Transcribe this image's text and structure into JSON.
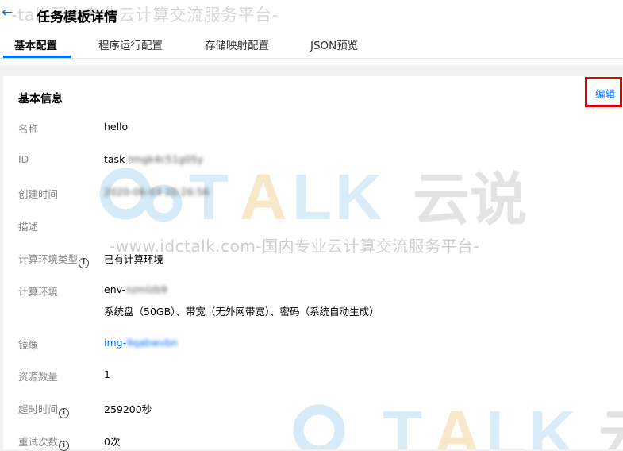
{
  "header": {
    "back_icon": "arrow-left-icon",
    "title": "任务模板详情",
    "watermark": "-talk国内专业云计算交流服务平台-"
  },
  "tabs": [
    {
      "label": "基本配置",
      "active": true
    },
    {
      "label": "程序运行配置",
      "active": false
    },
    {
      "label": "存储映射配置",
      "active": false
    },
    {
      "label": "JSON预览",
      "active": false
    }
  ],
  "section": {
    "title": "基本信息",
    "edit_label": "编辑"
  },
  "fields": {
    "name": {
      "label": "名称",
      "value": "hello"
    },
    "id": {
      "label": "ID",
      "prefix": "task-",
      "masked": "tmgk4c51g05y"
    },
    "created": {
      "label": "创建时间",
      "value": "2020-06-03 20:26:56"
    },
    "description": {
      "label": "描述",
      "value": ""
    },
    "env_type": {
      "label": "计算环境类型",
      "value": "已有计算环境"
    },
    "env": {
      "label": "计算环境",
      "prefix": "env-",
      "masked": "nzmlzb9",
      "detail": "系统盘（50GB）、带宽（无外网带宽）、密码（系统自动生成）"
    },
    "image": {
      "label": "镜像",
      "prefix": "img-",
      "masked": "9qabwvbn"
    },
    "resource_count": {
      "label": "资源数量",
      "value": "1"
    },
    "timeout": {
      "label": "超时时间",
      "value": "259200秒"
    },
    "retry": {
      "label": "重试次数",
      "value": "0次"
    }
  },
  "watermark": {
    "logo_text": "TALK",
    "logo_cn": "云说",
    "site": "-www.idctalk.com-国内专业云计算交流服务平台-"
  },
  "colors": {
    "accent": "#006eff",
    "highlight_box": "#e00000"
  }
}
